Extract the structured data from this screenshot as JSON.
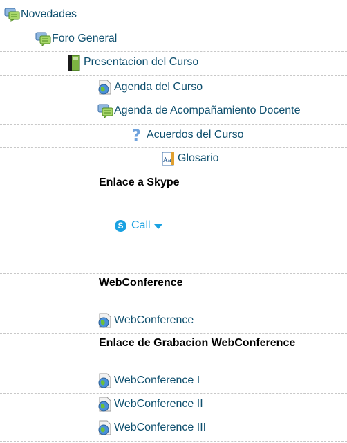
{
  "items": {
    "novedades": "Novedades",
    "foro_general": "Foro General",
    "presentacion": "Presentacion del Curso",
    "agenda_curso": "Agenda del Curso",
    "agenda_acompanamiento": "Agenda de Acompañamiento Docente",
    "acuerdos": "Acuerdos del Curso",
    "glosario": "Glosario",
    "webconference_link": "WebConference",
    "webconference_1": "WebConference I",
    "webconference_2": "WebConference II",
    "webconference_3": "WebConference III"
  },
  "headings": {
    "skype": "Enlace a Skype",
    "webconference": "WebConference",
    "grabacion": "Enlace de Grabacion WebConference"
  },
  "skype_button": {
    "label": "Call"
  },
  "icons": {
    "forum": "forum-icon",
    "book": "book-icon",
    "url": "url-globe-icon",
    "question": "question-icon",
    "glossary": "glossary-icon",
    "skype": "skype-icon"
  },
  "colors": {
    "link": "#0e4f6e",
    "skype": "#1aa1e1",
    "separator": "#c8c8c8"
  }
}
